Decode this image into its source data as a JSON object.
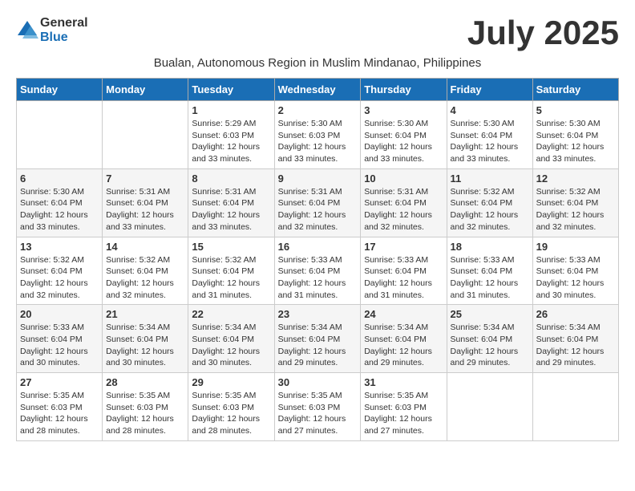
{
  "header": {
    "logo_general": "General",
    "logo_blue": "Blue",
    "month_year": "July 2025",
    "subtitle": "Bualan, Autonomous Region in Muslim Mindanao, Philippines"
  },
  "weekdays": [
    "Sunday",
    "Monday",
    "Tuesday",
    "Wednesday",
    "Thursday",
    "Friday",
    "Saturday"
  ],
  "weeks": [
    [
      {
        "day": "",
        "sunrise": "",
        "sunset": "",
        "daylight": ""
      },
      {
        "day": "",
        "sunrise": "",
        "sunset": "",
        "daylight": ""
      },
      {
        "day": "1",
        "sunrise": "Sunrise: 5:29 AM",
        "sunset": "Sunset: 6:03 PM",
        "daylight": "Daylight: 12 hours and 33 minutes."
      },
      {
        "day": "2",
        "sunrise": "Sunrise: 5:30 AM",
        "sunset": "Sunset: 6:03 PM",
        "daylight": "Daylight: 12 hours and 33 minutes."
      },
      {
        "day": "3",
        "sunrise": "Sunrise: 5:30 AM",
        "sunset": "Sunset: 6:04 PM",
        "daylight": "Daylight: 12 hours and 33 minutes."
      },
      {
        "day": "4",
        "sunrise": "Sunrise: 5:30 AM",
        "sunset": "Sunset: 6:04 PM",
        "daylight": "Daylight: 12 hours and 33 minutes."
      },
      {
        "day": "5",
        "sunrise": "Sunrise: 5:30 AM",
        "sunset": "Sunset: 6:04 PM",
        "daylight": "Daylight: 12 hours and 33 minutes."
      }
    ],
    [
      {
        "day": "6",
        "sunrise": "Sunrise: 5:30 AM",
        "sunset": "Sunset: 6:04 PM",
        "daylight": "Daylight: 12 hours and 33 minutes."
      },
      {
        "day": "7",
        "sunrise": "Sunrise: 5:31 AM",
        "sunset": "Sunset: 6:04 PM",
        "daylight": "Daylight: 12 hours and 33 minutes."
      },
      {
        "day": "8",
        "sunrise": "Sunrise: 5:31 AM",
        "sunset": "Sunset: 6:04 PM",
        "daylight": "Daylight: 12 hours and 33 minutes."
      },
      {
        "day": "9",
        "sunrise": "Sunrise: 5:31 AM",
        "sunset": "Sunset: 6:04 PM",
        "daylight": "Daylight: 12 hours and 32 minutes."
      },
      {
        "day": "10",
        "sunrise": "Sunrise: 5:31 AM",
        "sunset": "Sunset: 6:04 PM",
        "daylight": "Daylight: 12 hours and 32 minutes."
      },
      {
        "day": "11",
        "sunrise": "Sunrise: 5:32 AM",
        "sunset": "Sunset: 6:04 PM",
        "daylight": "Daylight: 12 hours and 32 minutes."
      },
      {
        "day": "12",
        "sunrise": "Sunrise: 5:32 AM",
        "sunset": "Sunset: 6:04 PM",
        "daylight": "Daylight: 12 hours and 32 minutes."
      }
    ],
    [
      {
        "day": "13",
        "sunrise": "Sunrise: 5:32 AM",
        "sunset": "Sunset: 6:04 PM",
        "daylight": "Daylight: 12 hours and 32 minutes."
      },
      {
        "day": "14",
        "sunrise": "Sunrise: 5:32 AM",
        "sunset": "Sunset: 6:04 PM",
        "daylight": "Daylight: 12 hours and 32 minutes."
      },
      {
        "day": "15",
        "sunrise": "Sunrise: 5:32 AM",
        "sunset": "Sunset: 6:04 PM",
        "daylight": "Daylight: 12 hours and 31 minutes."
      },
      {
        "day": "16",
        "sunrise": "Sunrise: 5:33 AM",
        "sunset": "Sunset: 6:04 PM",
        "daylight": "Daylight: 12 hours and 31 minutes."
      },
      {
        "day": "17",
        "sunrise": "Sunrise: 5:33 AM",
        "sunset": "Sunset: 6:04 PM",
        "daylight": "Daylight: 12 hours and 31 minutes."
      },
      {
        "day": "18",
        "sunrise": "Sunrise: 5:33 AM",
        "sunset": "Sunset: 6:04 PM",
        "daylight": "Daylight: 12 hours and 31 minutes."
      },
      {
        "day": "19",
        "sunrise": "Sunrise: 5:33 AM",
        "sunset": "Sunset: 6:04 PM",
        "daylight": "Daylight: 12 hours and 30 minutes."
      }
    ],
    [
      {
        "day": "20",
        "sunrise": "Sunrise: 5:33 AM",
        "sunset": "Sunset: 6:04 PM",
        "daylight": "Daylight: 12 hours and 30 minutes."
      },
      {
        "day": "21",
        "sunrise": "Sunrise: 5:34 AM",
        "sunset": "Sunset: 6:04 PM",
        "daylight": "Daylight: 12 hours and 30 minutes."
      },
      {
        "day": "22",
        "sunrise": "Sunrise: 5:34 AM",
        "sunset": "Sunset: 6:04 PM",
        "daylight": "Daylight: 12 hours and 30 minutes."
      },
      {
        "day": "23",
        "sunrise": "Sunrise: 5:34 AM",
        "sunset": "Sunset: 6:04 PM",
        "daylight": "Daylight: 12 hours and 29 minutes."
      },
      {
        "day": "24",
        "sunrise": "Sunrise: 5:34 AM",
        "sunset": "Sunset: 6:04 PM",
        "daylight": "Daylight: 12 hours and 29 minutes."
      },
      {
        "day": "25",
        "sunrise": "Sunrise: 5:34 AM",
        "sunset": "Sunset: 6:04 PM",
        "daylight": "Daylight: 12 hours and 29 minutes."
      },
      {
        "day": "26",
        "sunrise": "Sunrise: 5:34 AM",
        "sunset": "Sunset: 6:04 PM",
        "daylight": "Daylight: 12 hours and 29 minutes."
      }
    ],
    [
      {
        "day": "27",
        "sunrise": "Sunrise: 5:35 AM",
        "sunset": "Sunset: 6:03 PM",
        "daylight": "Daylight: 12 hours and 28 minutes."
      },
      {
        "day": "28",
        "sunrise": "Sunrise: 5:35 AM",
        "sunset": "Sunset: 6:03 PM",
        "daylight": "Daylight: 12 hours and 28 minutes."
      },
      {
        "day": "29",
        "sunrise": "Sunrise: 5:35 AM",
        "sunset": "Sunset: 6:03 PM",
        "daylight": "Daylight: 12 hours and 28 minutes."
      },
      {
        "day": "30",
        "sunrise": "Sunrise: 5:35 AM",
        "sunset": "Sunset: 6:03 PM",
        "daylight": "Daylight: 12 hours and 27 minutes."
      },
      {
        "day": "31",
        "sunrise": "Sunrise: 5:35 AM",
        "sunset": "Sunset: 6:03 PM",
        "daylight": "Daylight: 12 hours and 27 minutes."
      },
      {
        "day": "",
        "sunrise": "",
        "sunset": "",
        "daylight": ""
      },
      {
        "day": "",
        "sunrise": "",
        "sunset": "",
        "daylight": ""
      }
    ]
  ]
}
